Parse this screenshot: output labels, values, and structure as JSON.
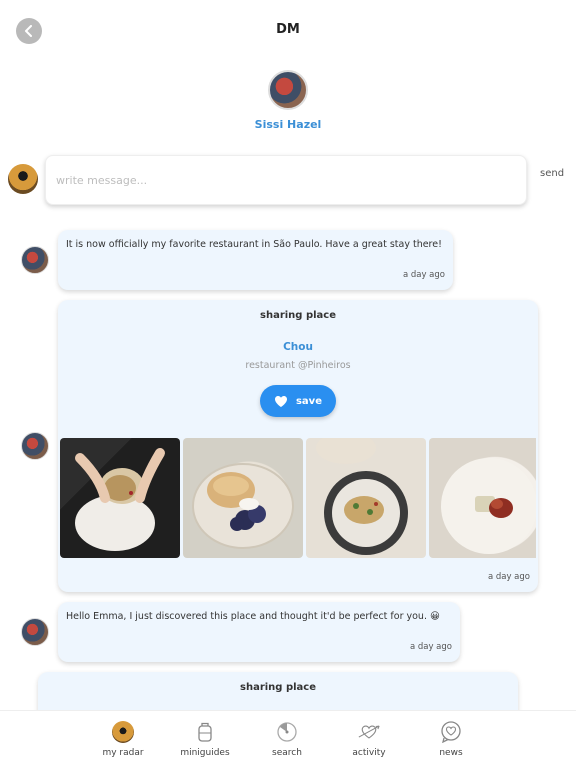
{
  "header": {
    "title": "DM",
    "back_icon": "chevron-left-icon"
  },
  "profile": {
    "name": "Sissi Hazel"
  },
  "composer": {
    "placeholder": "write message...",
    "send_label": "send"
  },
  "messages": [
    {
      "text": "It is now officially my favorite restaurant in São Paulo. Have a great stay there!",
      "time": "a day ago"
    },
    {
      "text": "Hello Emma, I just discovered this place and thought it'd be perfect for you. 😀",
      "time": "a day ago"
    }
  ],
  "share_cards": [
    {
      "title": "sharing place",
      "place": "Chou",
      "subtitle": "restaurant @Pinheiros",
      "save_label": "save",
      "time": "a day ago"
    },
    {
      "title": "sharing place"
    }
  ],
  "nav": [
    {
      "label": "my radar",
      "icon": "avatar-icon"
    },
    {
      "label": "miniguides",
      "icon": "suitcase-icon"
    },
    {
      "label": "search",
      "icon": "search-radar-icon"
    },
    {
      "label": "activity",
      "icon": "heart-arrow-icon"
    },
    {
      "label": "news",
      "icon": "speech-heart-icon"
    }
  ],
  "colors": {
    "accent": "#2a8ff0",
    "link": "#3b8fd6",
    "bubble": "#eef6fe"
  }
}
